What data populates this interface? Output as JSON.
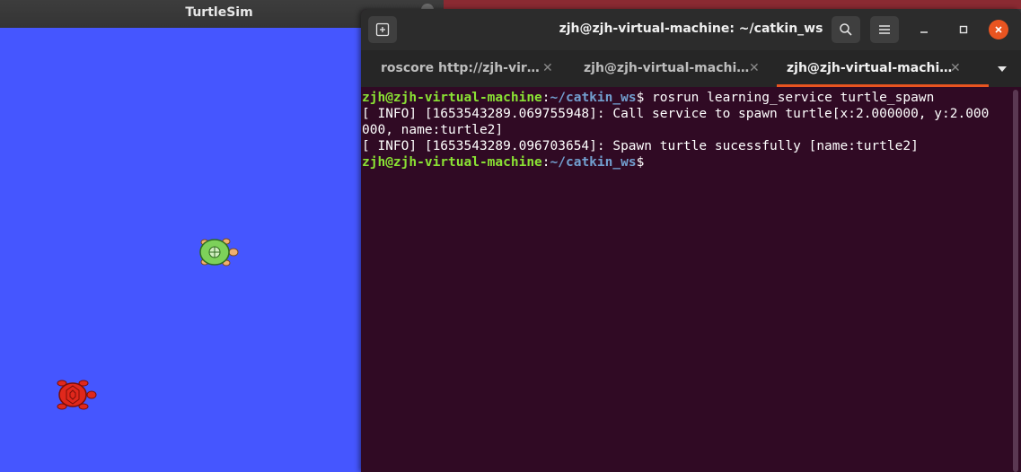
{
  "turtlesim": {
    "title": "TurtleSim",
    "background_color": "#4556ff",
    "turtles": [
      {
        "name": "turtle",
        "shell_color": "#7dd15a",
        "icon": "green-turtle-icon"
      },
      {
        "name": "turtle",
        "shell_color": "#e0281c",
        "icon": "red-turtle-icon"
      }
    ]
  },
  "terminal": {
    "title": "zjh@zjh-virtual-machine: ~/catkin_ws",
    "new_tab_icon": "new-tab-icon",
    "search_icon": "search-icon",
    "menu_icon": "hamburger-menu-icon",
    "tabs": [
      {
        "label": "roscore http://zjh-vir…",
        "active": false
      },
      {
        "label": "zjh@zjh-virtual-machi…",
        "active": false
      },
      {
        "label": "zjh@zjh-virtual-machi…",
        "active": true
      }
    ],
    "accent_color": "#e95420",
    "background_color": "#300a24",
    "lines": {
      "l1_user": "zjh@zjh-virtual-machine",
      "l1_sep": ":",
      "l1_path": "~/catkin_ws",
      "l1_cmd": "$ rosrun learning_service turtle_spawn",
      "l2": "[ INFO] [1653543289.069755948]: Call service to spawn turtle[x:2.000000, y:2.000",
      "l3": "000, name:turtle2]",
      "l4": "[ INFO] [1653543289.096703654]: Spawn turtle sucessfully [name:turtle2]",
      "l5_user": "zjh@zjh-virtual-machine",
      "l5_sep": ":",
      "l5_path": "~/catkin_ws",
      "l5_end": "$"
    }
  }
}
